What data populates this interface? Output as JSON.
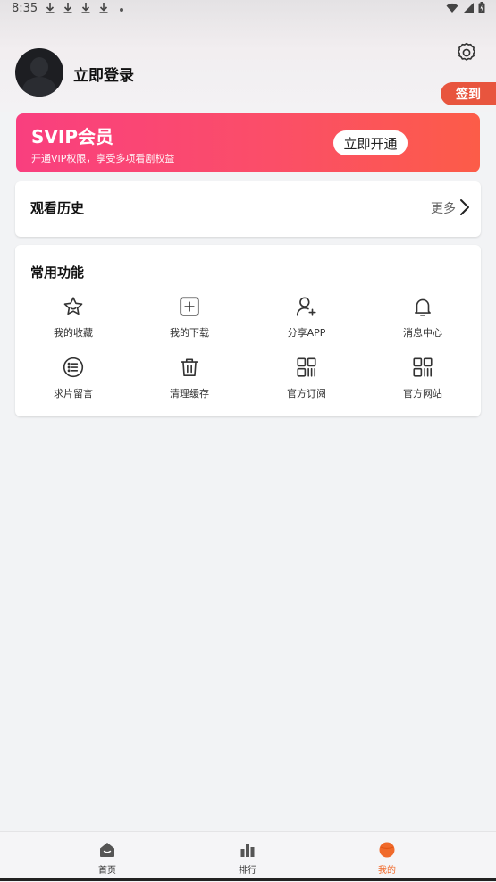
{
  "status_bar": {
    "time": "8:35"
  },
  "profile": {
    "login_label": "立即登录",
    "signin_label": "签到"
  },
  "svip": {
    "title": "SVIP会员",
    "subtitle": "开通VIP权限，享受多项看剧权益",
    "button_label": "立即开通"
  },
  "history": {
    "title": "观看历史",
    "more_label": "更多"
  },
  "functions": {
    "title": "常用功能",
    "items": [
      {
        "label": "我的收藏",
        "icon": "star-icon"
      },
      {
        "label": "我的下载",
        "icon": "plus-square-icon"
      },
      {
        "label": "分享APP",
        "icon": "add-user-icon"
      },
      {
        "label": "消息中心",
        "icon": "bell-icon"
      },
      {
        "label": "求片留言",
        "icon": "list-circle-icon"
      },
      {
        "label": "清理缓存",
        "icon": "trash-icon"
      },
      {
        "label": "官方订阅",
        "icon": "qr-grid-icon"
      },
      {
        "label": "官方网站",
        "icon": "qr-grid-icon"
      }
    ]
  },
  "tabbar": {
    "items": [
      {
        "label": "首页",
        "icon": "home-icon"
      },
      {
        "label": "排行",
        "icon": "bar-chart-icon"
      },
      {
        "label": "我的",
        "icon": "profile-ball-icon"
      }
    ],
    "active_index": 2
  },
  "colors": {
    "accent": "#f06a2b",
    "signin": "#e8553e",
    "svip_gradient_start": "#f93f7f",
    "svip_gradient_end": "#fc5c48"
  }
}
